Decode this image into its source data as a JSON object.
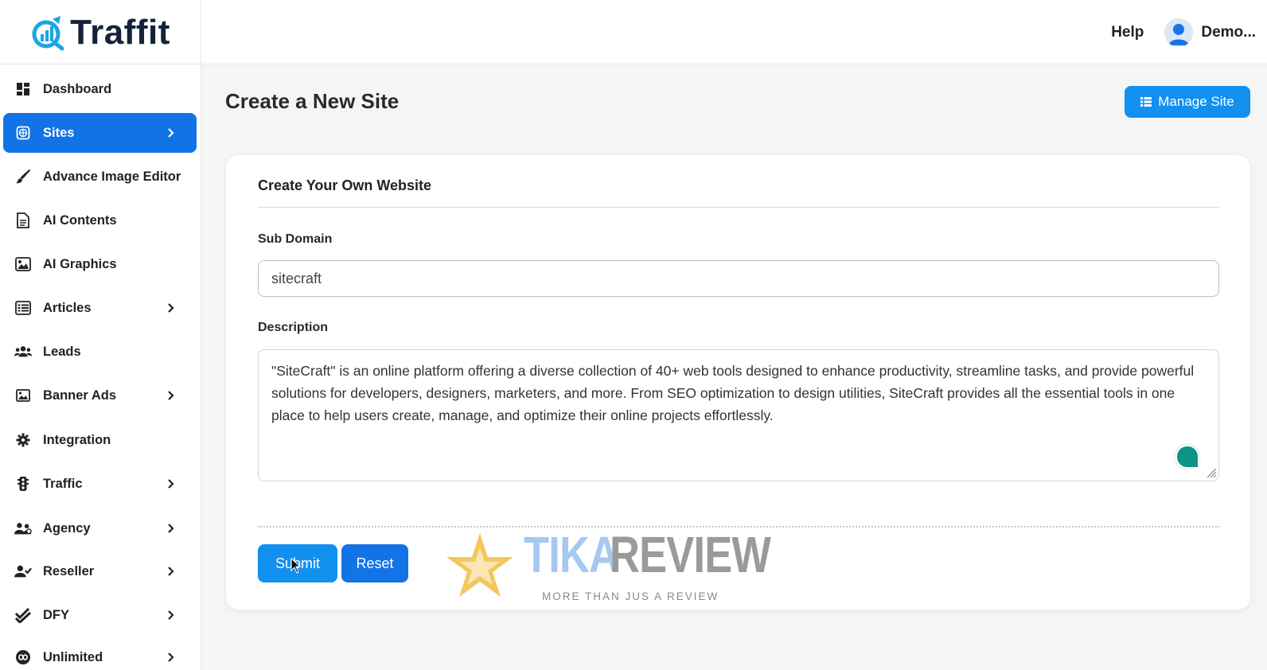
{
  "brand": {
    "name": "Traffit",
    "accent": "#1273e6",
    "button": "#1190f0"
  },
  "header": {
    "help": "Help",
    "user_name": "Demo..."
  },
  "sidebar": {
    "items": [
      {
        "label": "Dashboard",
        "icon": "dashboard-icon",
        "has_submenu": false,
        "active": false
      },
      {
        "label": "Sites",
        "icon": "globe-icon",
        "has_submenu": true,
        "active": true
      },
      {
        "label": "Advance Image Editor",
        "icon": "brush-icon",
        "has_submenu": false,
        "active": false
      },
      {
        "label": "AI Contents",
        "icon": "document-icon",
        "has_submenu": false,
        "active": false
      },
      {
        "label": "AI Graphics",
        "icon": "image-icon",
        "has_submenu": false,
        "active": false
      },
      {
        "label": "Articles",
        "icon": "list-icon",
        "has_submenu": true,
        "active": false
      },
      {
        "label": "Leads",
        "icon": "users-icon",
        "has_submenu": false,
        "active": false
      },
      {
        "label": "Banner Ads",
        "icon": "banner-image-icon",
        "has_submenu": true,
        "active": false
      },
      {
        "label": "Integration",
        "icon": "gear-icon",
        "has_submenu": false,
        "active": false
      },
      {
        "label": "Traffic",
        "icon": "traffic-light-icon",
        "has_submenu": true,
        "active": false
      },
      {
        "label": "Agency",
        "icon": "team-icon",
        "has_submenu": true,
        "active": false
      },
      {
        "label": "Reseller",
        "icon": "user-check-icon",
        "has_submenu": true,
        "active": false
      },
      {
        "label": "DFY",
        "icon": "double-check-icon",
        "has_submenu": true,
        "active": false
      },
      {
        "label": "Unlimited",
        "icon": "infinity-icon",
        "has_submenu": true,
        "active": false
      }
    ]
  },
  "main": {
    "title": "Create a New Site",
    "manage_button": "Manage Site",
    "form": {
      "title": "Create Your Own Website",
      "subdomain_label": "Sub Domain",
      "subdomain_value": "sitecraft",
      "description_label": "Description",
      "description_value": "\"SiteCraft\" is an online platform offering a diverse collection of 40+ web tools designed to enhance productivity, streamline tasks, and provide powerful solutions for developers, designers, marketers, and more. From SEO optimization to design utilities, SiteCraft provides all the essential tools in one place to help users create, manage, and optimize their online projects effortlessly.",
      "submit": "Submit",
      "reset": "Reset"
    }
  },
  "watermark": {
    "word1": "TIKA",
    "word2": "REVIEW",
    "tagline": "MORE THAN JUS A REVIEW"
  }
}
